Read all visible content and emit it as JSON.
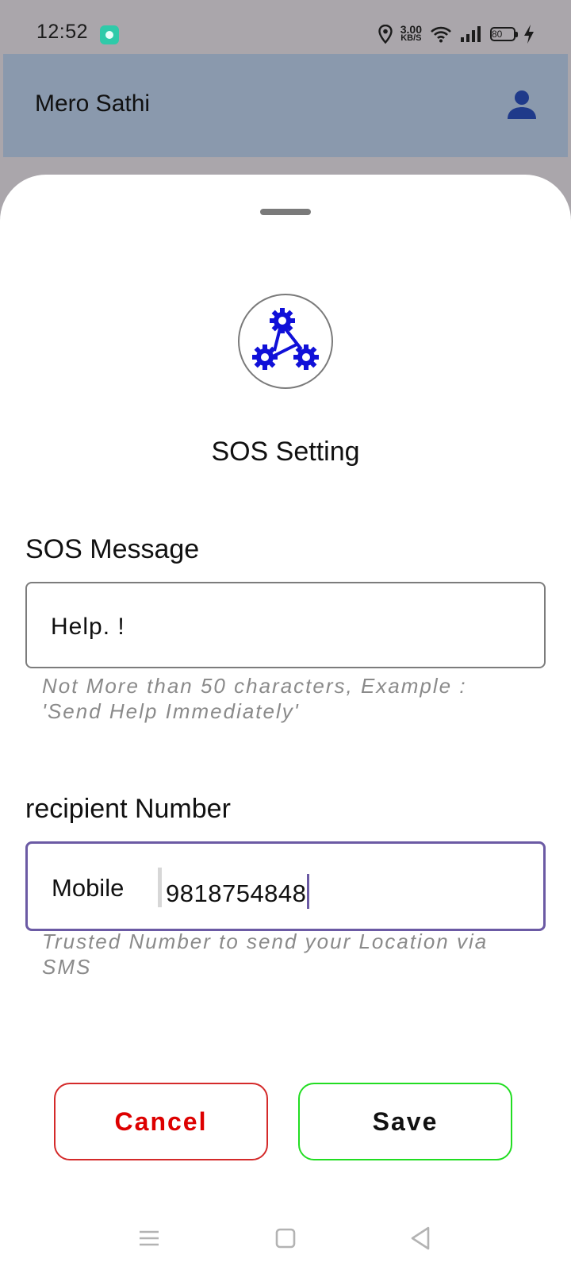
{
  "status_bar": {
    "time": "12:52",
    "speed_value": "3.00",
    "speed_unit": "KB/S",
    "battery": "80"
  },
  "app_bar": {
    "title": "Mero Sathi"
  },
  "sheet": {
    "title": "SOS Setting",
    "message_label": "SOS Message",
    "message_value": "Help. !",
    "message_helper": "Not More than 50 characters, Example : 'Send Help Immediately'",
    "number_label": "recipient Number",
    "number_prefix": "Mobile",
    "number_value": "9818754848",
    "number_helper": "Trusted Number to send your Location via SMS",
    "cancel_label": "Cancel",
    "save_label": "Save"
  },
  "colors": {
    "app_bar": "#8a99ad",
    "icon_blue": "#1010d8",
    "cancel_red": "#dd0000",
    "save_green": "#22dd22",
    "focus_purple": "#6b5aa4"
  }
}
